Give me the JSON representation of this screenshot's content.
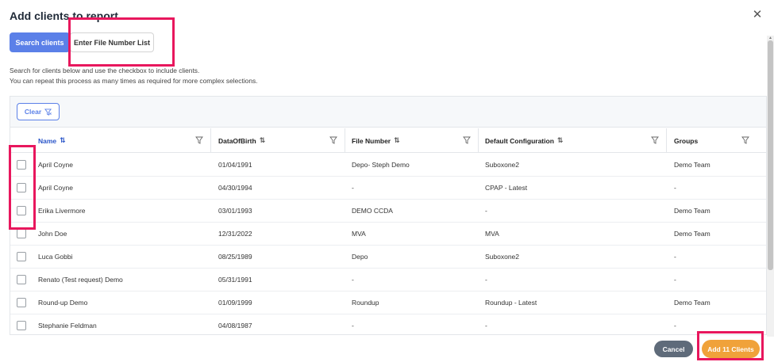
{
  "dialog": {
    "title": "Add clients to report",
    "close_icon": "close-icon"
  },
  "tabs": {
    "search_label": "Search clients",
    "file_label": "Enter File Number List"
  },
  "help": {
    "line1": "Search for clients below and use the checkbox to include clients.",
    "line2": "You can repeat this process as many times as required for more complex selections."
  },
  "toolbar": {
    "clear_label": "Clear",
    "clear_icon": "filter-clear-icon"
  },
  "table": {
    "columns": [
      {
        "label": "Name",
        "sort": "⇅"
      },
      {
        "label": "DataOfBirth",
        "sort": "⇅"
      },
      {
        "label": "File Number",
        "sort": "⇅"
      },
      {
        "label": "Default Configuration",
        "sort": "⇅"
      },
      {
        "label": "Groups",
        "sort": ""
      }
    ],
    "rows": [
      {
        "name": "April Coyne",
        "dob": "01/04/1991",
        "file": "Depo- Steph Demo",
        "config": "Suboxone2",
        "groups": "Demo Team"
      },
      {
        "name": "April Coyne",
        "dob": "04/30/1994",
        "file": "-",
        "config": "CPAP - Latest",
        "groups": "-"
      },
      {
        "name": "Erika Livermore",
        "dob": "03/01/1993",
        "file": "DEMO CCDA",
        "config": "-",
        "groups": "Demo Team"
      },
      {
        "name": "John Doe",
        "dob": "12/31/2022",
        "file": "MVA",
        "config": "MVA",
        "groups": "Demo Team"
      },
      {
        "name": "Luca Gobbi",
        "dob": "08/25/1989",
        "file": "Depo",
        "config": "Suboxone2",
        "groups": "-"
      },
      {
        "name": "Renato (Test request) Demo",
        "dob": "05/31/1991",
        "file": "-",
        "config": "-",
        "groups": "-"
      },
      {
        "name": "Round-up Demo",
        "dob": "01/09/1999",
        "file": "Roundup",
        "config": "Roundup - Latest",
        "groups": "Demo Team"
      },
      {
        "name": "Stephanie Feldman",
        "dob": "04/08/1987",
        "file": "-",
        "config": "-",
        "groups": "-"
      }
    ]
  },
  "footer": {
    "cancel_label": "Cancel",
    "add_label": "Add 11 Clients"
  },
  "colors": {
    "primary": "#5b80e8",
    "accent": "#f0a23a",
    "highlight": "#e8175d",
    "cancel": "#5f6b7a"
  }
}
